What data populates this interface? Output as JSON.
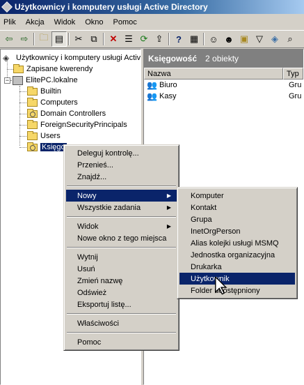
{
  "window": {
    "title": "Użytkownicy i komputery usługi Active Directory"
  },
  "menubar": [
    "Plik",
    "Akcja",
    "Widok",
    "Okno",
    "Pomoc"
  ],
  "toolbar": {
    "icons": [
      "back-icon",
      "forward-icon",
      "up-folder-icon",
      "console-tree-icon",
      "cut-icon",
      "copy-icon",
      "delete-icon",
      "properties-icon",
      "refresh-icon",
      "export-icon",
      "help-icon",
      "details-icon",
      "new-user-icon",
      "new-group-icon",
      "new-ou-icon",
      "filter-icon",
      "add-to-group-icon",
      "find-icon"
    ]
  },
  "tree": {
    "root": "Użytkownicy i komputery usługi Activ",
    "saved_queries": "Zapisane kwerendy",
    "domain": "ElitePC.lokalne",
    "children": [
      "Builtin",
      "Computers",
      "Domain Controllers",
      "ForeignSecurityPrincipals",
      "Users"
    ],
    "selected": "Księgo"
  },
  "right_pane": {
    "header_title": "Księgowość",
    "header_count": "2 obiekty",
    "columns": [
      "Nazwa",
      "Typ"
    ],
    "rows": [
      {
        "name": "Biuro",
        "type": "Gru"
      },
      {
        "name": "Kasy",
        "type": "Gru"
      }
    ]
  },
  "context_menu": {
    "items_group1": [
      "Deleguj kontrolę...",
      "Przenieś...",
      "Znajdź..."
    ],
    "new_item": "Nowy",
    "all_tasks": "Wszystkie zadania",
    "view": "Widok",
    "new_window": "Nowe okno z tego miejsca",
    "items_group4": [
      "Wytnij",
      "Usuń",
      "Zmień nazwę",
      "Odśwież",
      "Eksportuj listę..."
    ],
    "properties": "Właściwości",
    "help": "Pomoc"
  },
  "submenu": {
    "items": [
      "Komputer",
      "Kontakt",
      "Grupa",
      "InetOrgPerson",
      "Alias kolejki usługi MSMQ",
      "Jednostka organizacyjna",
      "Drukarka",
      "Użytkownik",
      "Folder udostępniony"
    ],
    "highlighted": "Użytkownik"
  },
  "colors": {
    "highlight": "#0a246a",
    "face": "#d4d0c8",
    "folder": "#f6d768"
  }
}
